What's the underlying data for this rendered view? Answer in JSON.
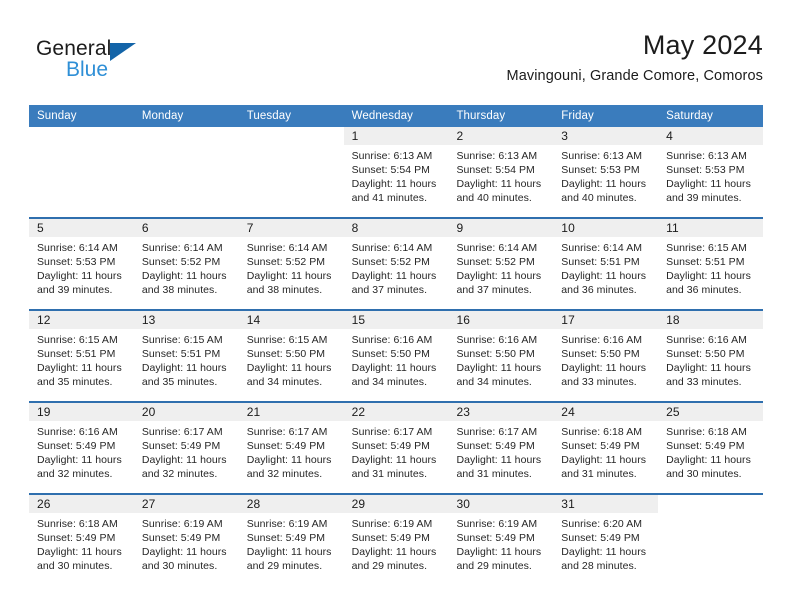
{
  "brand": {
    "name_part1": "General",
    "name_part2": "Blue",
    "triangle_color": "#1364a8",
    "blue_text_color": "#2f8fd6"
  },
  "header": {
    "title": "May 2024",
    "subtitle": "Mavingouni, Grande Comore, Comoros"
  },
  "theme": {
    "header_bar_color": "#3a7cbd",
    "week_separator_color": "#2f6fae",
    "date_band_color": "#efefef",
    "text_color": "#1c1c1c"
  },
  "weekdays": [
    "Sunday",
    "Monday",
    "Tuesday",
    "Wednesday",
    "Thursday",
    "Friday",
    "Saturday"
  ],
  "weeks": [
    [
      {
        "day": "",
        "lines": []
      },
      {
        "day": "",
        "lines": []
      },
      {
        "day": "",
        "lines": []
      },
      {
        "day": "1",
        "lines": [
          "Sunrise: 6:13 AM",
          "Sunset: 5:54 PM",
          "Daylight: 11 hours",
          "and 41 minutes."
        ]
      },
      {
        "day": "2",
        "lines": [
          "Sunrise: 6:13 AM",
          "Sunset: 5:54 PM",
          "Daylight: 11 hours",
          "and 40 minutes."
        ]
      },
      {
        "day": "3",
        "lines": [
          "Sunrise: 6:13 AM",
          "Sunset: 5:53 PM",
          "Daylight: 11 hours",
          "and 40 minutes."
        ]
      },
      {
        "day": "4",
        "lines": [
          "Sunrise: 6:13 AM",
          "Sunset: 5:53 PM",
          "Daylight: 11 hours",
          "and 39 minutes."
        ]
      }
    ],
    [
      {
        "day": "5",
        "lines": [
          "Sunrise: 6:14 AM",
          "Sunset: 5:53 PM",
          "Daylight: 11 hours",
          "and 39 minutes."
        ]
      },
      {
        "day": "6",
        "lines": [
          "Sunrise: 6:14 AM",
          "Sunset: 5:52 PM",
          "Daylight: 11 hours",
          "and 38 minutes."
        ]
      },
      {
        "day": "7",
        "lines": [
          "Sunrise: 6:14 AM",
          "Sunset: 5:52 PM",
          "Daylight: 11 hours",
          "and 38 minutes."
        ]
      },
      {
        "day": "8",
        "lines": [
          "Sunrise: 6:14 AM",
          "Sunset: 5:52 PM",
          "Daylight: 11 hours",
          "and 37 minutes."
        ]
      },
      {
        "day": "9",
        "lines": [
          "Sunrise: 6:14 AM",
          "Sunset: 5:52 PM",
          "Daylight: 11 hours",
          "and 37 minutes."
        ]
      },
      {
        "day": "10",
        "lines": [
          "Sunrise: 6:14 AM",
          "Sunset: 5:51 PM",
          "Daylight: 11 hours",
          "and 36 minutes."
        ]
      },
      {
        "day": "11",
        "lines": [
          "Sunrise: 6:15 AM",
          "Sunset: 5:51 PM",
          "Daylight: 11 hours",
          "and 36 minutes."
        ]
      }
    ],
    [
      {
        "day": "12",
        "lines": [
          "Sunrise: 6:15 AM",
          "Sunset: 5:51 PM",
          "Daylight: 11 hours",
          "and 35 minutes."
        ]
      },
      {
        "day": "13",
        "lines": [
          "Sunrise: 6:15 AM",
          "Sunset: 5:51 PM",
          "Daylight: 11 hours",
          "and 35 minutes."
        ]
      },
      {
        "day": "14",
        "lines": [
          "Sunrise: 6:15 AM",
          "Sunset: 5:50 PM",
          "Daylight: 11 hours",
          "and 34 minutes."
        ]
      },
      {
        "day": "15",
        "lines": [
          "Sunrise: 6:16 AM",
          "Sunset: 5:50 PM",
          "Daylight: 11 hours",
          "and 34 minutes."
        ]
      },
      {
        "day": "16",
        "lines": [
          "Sunrise: 6:16 AM",
          "Sunset: 5:50 PM",
          "Daylight: 11 hours",
          "and 34 minutes."
        ]
      },
      {
        "day": "17",
        "lines": [
          "Sunrise: 6:16 AM",
          "Sunset: 5:50 PM",
          "Daylight: 11 hours",
          "and 33 minutes."
        ]
      },
      {
        "day": "18",
        "lines": [
          "Sunrise: 6:16 AM",
          "Sunset: 5:50 PM",
          "Daylight: 11 hours",
          "and 33 minutes."
        ]
      }
    ],
    [
      {
        "day": "19",
        "lines": [
          "Sunrise: 6:16 AM",
          "Sunset: 5:49 PM",
          "Daylight: 11 hours",
          "and 32 minutes."
        ]
      },
      {
        "day": "20",
        "lines": [
          "Sunrise: 6:17 AM",
          "Sunset: 5:49 PM",
          "Daylight: 11 hours",
          "and 32 minutes."
        ]
      },
      {
        "day": "21",
        "lines": [
          "Sunrise: 6:17 AM",
          "Sunset: 5:49 PM",
          "Daylight: 11 hours",
          "and 32 minutes."
        ]
      },
      {
        "day": "22",
        "lines": [
          "Sunrise: 6:17 AM",
          "Sunset: 5:49 PM",
          "Daylight: 11 hours",
          "and 31 minutes."
        ]
      },
      {
        "day": "23",
        "lines": [
          "Sunrise: 6:17 AM",
          "Sunset: 5:49 PM",
          "Daylight: 11 hours",
          "and 31 minutes."
        ]
      },
      {
        "day": "24",
        "lines": [
          "Sunrise: 6:18 AM",
          "Sunset: 5:49 PM",
          "Daylight: 11 hours",
          "and 31 minutes."
        ]
      },
      {
        "day": "25",
        "lines": [
          "Sunrise: 6:18 AM",
          "Sunset: 5:49 PM",
          "Daylight: 11 hours",
          "and 30 minutes."
        ]
      }
    ],
    [
      {
        "day": "26",
        "lines": [
          "Sunrise: 6:18 AM",
          "Sunset: 5:49 PM",
          "Daylight: 11 hours",
          "and 30 minutes."
        ]
      },
      {
        "day": "27",
        "lines": [
          "Sunrise: 6:19 AM",
          "Sunset: 5:49 PM",
          "Daylight: 11 hours",
          "and 30 minutes."
        ]
      },
      {
        "day": "28",
        "lines": [
          "Sunrise: 6:19 AM",
          "Sunset: 5:49 PM",
          "Daylight: 11 hours",
          "and 29 minutes."
        ]
      },
      {
        "day": "29",
        "lines": [
          "Sunrise: 6:19 AM",
          "Sunset: 5:49 PM",
          "Daylight: 11 hours",
          "and 29 minutes."
        ]
      },
      {
        "day": "30",
        "lines": [
          "Sunrise: 6:19 AM",
          "Sunset: 5:49 PM",
          "Daylight: 11 hours",
          "and 29 minutes."
        ]
      },
      {
        "day": "31",
        "lines": [
          "Sunrise: 6:20 AM",
          "Sunset: 5:49 PM",
          "Daylight: 11 hours",
          "and 28 minutes."
        ]
      },
      {
        "day": "",
        "lines": []
      }
    ]
  ]
}
